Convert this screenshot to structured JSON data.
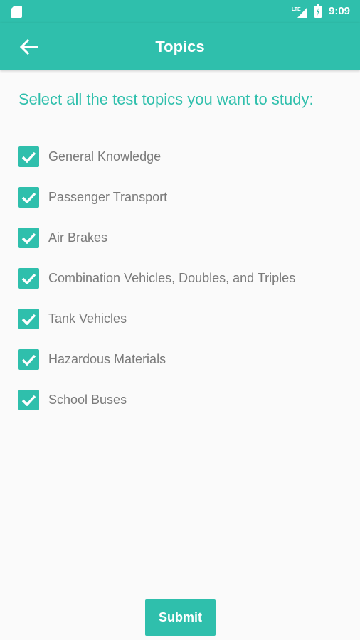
{
  "status_bar": {
    "time": "9:09",
    "icons": [
      "sd-card-icon",
      "signal-icon",
      "battery-icon"
    ]
  },
  "app_bar": {
    "title": "Topics",
    "back_icon": "arrow-back-icon"
  },
  "heading": "Select all the test topics you want to study:",
  "topics": [
    {
      "label": "General Knowledge",
      "checked": true
    },
    {
      "label": "Passenger Transport",
      "checked": true
    },
    {
      "label": "Air Brakes",
      "checked": true
    },
    {
      "label": "Combination Vehicles, Doubles, and Triples",
      "checked": true
    },
    {
      "label": "Tank Vehicles",
      "checked": true
    },
    {
      "label": "Hazardous Materials",
      "checked": true
    },
    {
      "label": "School Buses",
      "checked": true
    }
  ],
  "submit_label": "Submit",
  "colors": {
    "accent": "#2fbfac",
    "text_gray": "#7a7a7a",
    "background": "#fafafa"
  }
}
